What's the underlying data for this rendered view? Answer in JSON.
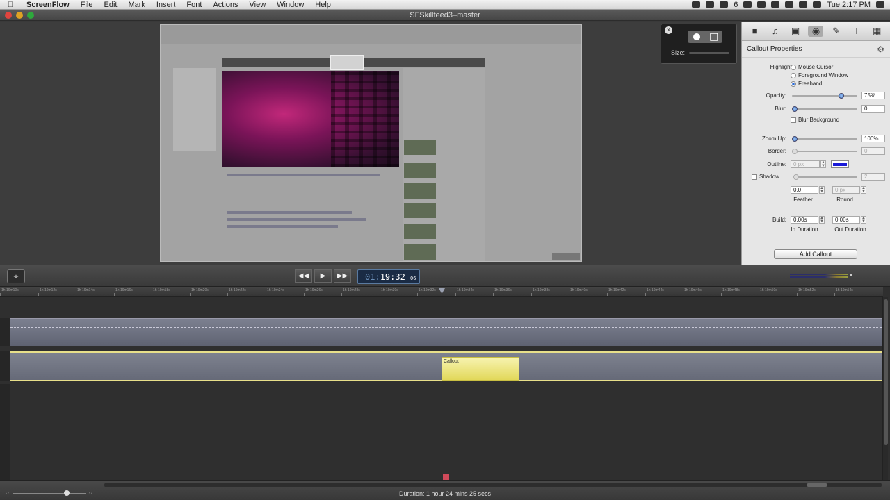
{
  "menubar": {
    "app": "ScreenFlow",
    "items": [
      "File",
      "Edit",
      "Mark",
      "Insert",
      "Font",
      "Actions",
      "View",
      "Window",
      "Help"
    ],
    "clock": "Tue 2:17 PM",
    "battery_label": "6"
  },
  "window": {
    "title": "SFSkillfeed3–master"
  },
  "hud": {
    "close": "×",
    "size_label": "Size:"
  },
  "inspector": {
    "title": "Callout Properties",
    "highlight_label": "Highlight:",
    "highlight_options": [
      "Mouse Cursor",
      "Foreground Window",
      "Freehand"
    ],
    "highlight_selected": "Freehand",
    "opacity_label": "Opacity:",
    "opacity_value": "75%",
    "opacity_level": 0.75,
    "blur_label": "Blur:",
    "blur_value": "0",
    "blur_background_label": "Blur Background",
    "zoom_label": "Zoom Up:",
    "zoom_value": "100%",
    "border_label": "Border:",
    "border_value": "0",
    "outline_label": "Outline:",
    "outline_value": "0 px",
    "outline_color": "#1a1ad8",
    "shadow_label": "Shadow",
    "shadow_value": "2",
    "feather_value": "0.0",
    "feather_label": "Feather",
    "round_value": "0 px",
    "round_label": "Round",
    "build_label": "Build:",
    "in_duration_value": "0.00s",
    "in_duration_label": "In Duration",
    "out_duration_value": "0.00s",
    "out_duration_label": "Out Duration",
    "add_callout": "Add Callout"
  },
  "transport": {
    "rewind": "◀◀",
    "play": "▶",
    "forward": "▶▶",
    "timecode_hours": "01:",
    "timecode_main": "19:32",
    "timecode_frames": "06"
  },
  "timeline": {
    "ruler_ticks": [
      "1h 19m10s",
      "1h 19m12s",
      "1h 19m14s",
      "1h 19m16s",
      "1h 19m18s",
      "1h 19m20s",
      "1h 19m22s",
      "1h 19m24s",
      "1h 19m26s",
      "1h 19m28s",
      "1h 19m30s",
      "1h 19m32s",
      "1h 19m34s",
      "1h 19m36s",
      "1h 19m38s",
      "1h 19m40s",
      "1h 19m42s",
      "1h 19m44s",
      "1h 19m46s",
      "1h 19m48s",
      "1h 19m50s",
      "1h 19m52s",
      "1h 19m54s"
    ],
    "callout_clip_label": "Callout"
  },
  "footer": {
    "duration": "Duration: 1 hour 24 mins 25 secs"
  },
  "colors": {
    "playhead": "#d04a5a",
    "callout_clip": "#e2d85a",
    "accent": "#2a6bd8"
  }
}
